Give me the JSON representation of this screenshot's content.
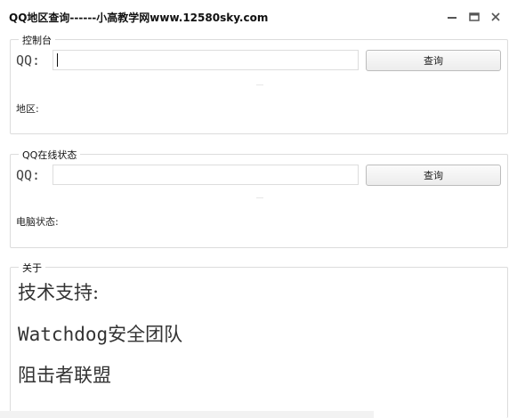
{
  "window": {
    "title": "QQ地区查询------小高教学网www.12580sky.com",
    "controls": {
      "minimize": "minimize-icon",
      "maximize": "maximize-icon",
      "close": "close-icon"
    }
  },
  "console_group": {
    "legend": "控制台",
    "qq_label": "QQ:",
    "qq_value": "",
    "query_label": "查询",
    "region_label": "地区:"
  },
  "status_group": {
    "legend": "QQ在线状态",
    "qq_label": "QQ:",
    "qq_value": "",
    "query_label": "查询",
    "pc_status_label": "电脑状态:"
  },
  "about_group": {
    "legend": "关于",
    "lines": [
      "技术支持:",
      "Watchdog安全团队",
      "阻击者联盟"
    ]
  },
  "colors": {
    "border": "#dcdcdc",
    "button_border": "#bcbcbc",
    "text": "#222222"
  }
}
